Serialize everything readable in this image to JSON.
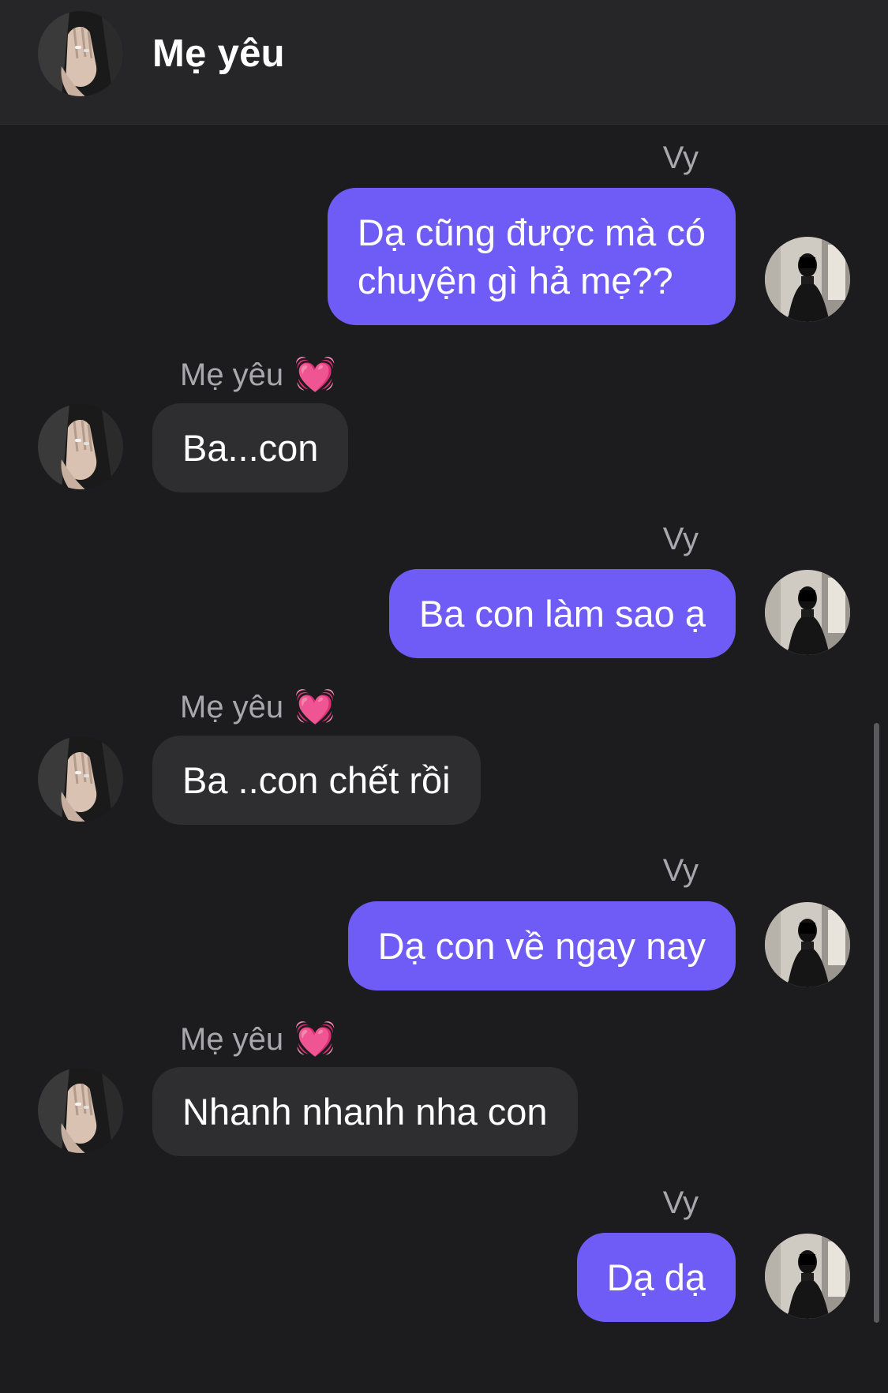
{
  "header": {
    "title": "Mẹ yêu",
    "avatar_icon": "hand-ring-avatar-icon"
  },
  "messages": [
    {
      "direction": "out",
      "sender": "Vy",
      "text_lines": [
        "Dạ cũng được mà có",
        "chuyện gì hả mẹ??"
      ]
    },
    {
      "direction": "in",
      "sender": "Mẹ yêu",
      "sender_icon": "💓",
      "text": "Ba...con"
    },
    {
      "direction": "out",
      "sender": "Vy",
      "text": "Ba con làm sao ạ"
    },
    {
      "direction": "in",
      "sender": "Mẹ yêu",
      "sender_icon": "💓",
      "text": "Ba ..con chết rồi"
    },
    {
      "direction": "out",
      "sender": "Vy",
      "text": "Dạ con về ngay nay"
    },
    {
      "direction": "in",
      "sender": "Mẹ yêu",
      "sender_icon": "💓",
      "text": "Nhanh nhanh nha con"
    },
    {
      "direction": "out",
      "sender": "Vy",
      "text": "Dạ dạ"
    }
  ],
  "colors": {
    "background": "#1c1c1e",
    "header": "#262629",
    "outgoing_bubble": "#6f5cf6",
    "incoming_bubble": "#2e2e30",
    "sender_name": "#a7a7ad"
  }
}
